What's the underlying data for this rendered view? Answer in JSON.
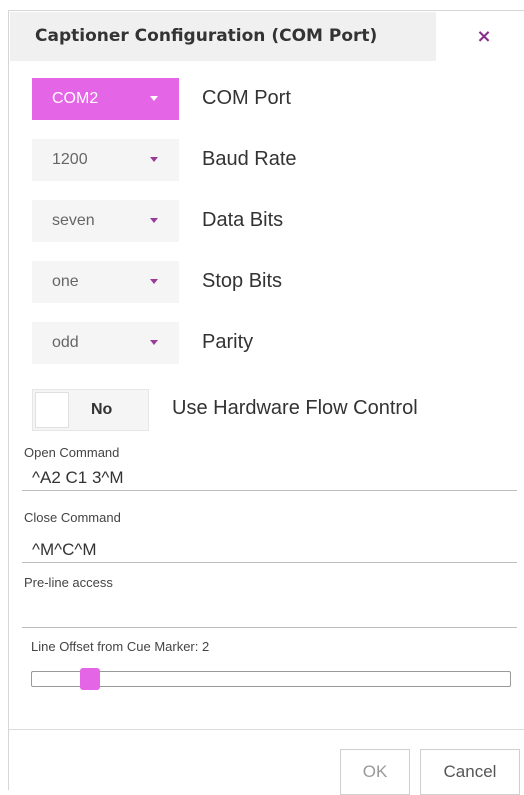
{
  "dialog": {
    "title": "Captioner Configuration (COM Port)",
    "close_icon": "×"
  },
  "settings": [
    {
      "value": "COM2",
      "label": "COM Port",
      "active": true
    },
    {
      "value": "1200",
      "label": "Baud Rate",
      "active": false
    },
    {
      "value": "seven",
      "label": "Data Bits",
      "active": false
    },
    {
      "value": "one",
      "label": "Stop Bits",
      "active": false
    },
    {
      "value": "odd",
      "label": "Parity",
      "active": false
    }
  ],
  "flow_control": {
    "toggle_text": "No",
    "label": "Use Hardware Flow Control"
  },
  "fields": {
    "open_command": {
      "label": "Open Command",
      "value": "^A2 C1 3^M"
    },
    "close_command": {
      "label": "Close Command",
      "value": "^M^C^M"
    },
    "pre_line_access": {
      "label": "Pre-line access",
      "value": ""
    }
  },
  "line_offset": {
    "label": "Line Offset from Cue Marker: 2",
    "value": 2,
    "min": 0,
    "max": 20
  },
  "buttons": {
    "ok": "OK",
    "cancel": "Cancel"
  },
  "colors": {
    "accent": "#e466e6",
    "close_icon": "#8b2c8b",
    "caret": "#9a3b9a"
  }
}
